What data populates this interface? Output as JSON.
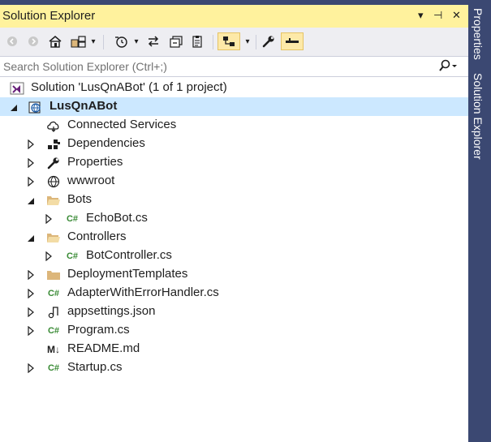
{
  "panel": {
    "title": "Solution Explorer",
    "controls": {
      "dropdown": "▾",
      "pin": "⊣",
      "close": "✕"
    }
  },
  "search": {
    "placeholder": "Search Solution Explorer (Ctrl+;)",
    "icon": "search-icon"
  },
  "tree": {
    "solution": "Solution 'LusQnABot' (1 of 1 project)",
    "project": "LusQnABot",
    "items": [
      {
        "label": "Connected Services",
        "icon": "cloud-icon"
      },
      {
        "label": "Dependencies",
        "icon": "dependencies-icon"
      },
      {
        "label": "Properties",
        "icon": "wrench-icon"
      },
      {
        "label": "wwwroot",
        "icon": "globe-icon"
      },
      {
        "label": "Bots",
        "icon": "folder-open-icon"
      },
      {
        "label": "EchoBot.cs",
        "icon": "csharp-file-icon"
      },
      {
        "label": "Controllers",
        "icon": "folder-open-icon"
      },
      {
        "label": "BotController.cs",
        "icon": "csharp-file-icon"
      },
      {
        "label": "DeploymentTemplates",
        "icon": "folder-icon"
      },
      {
        "label": "AdapterWithErrorHandler.cs",
        "icon": "csharp-file-icon"
      },
      {
        "label": "appsettings.json",
        "icon": "json-file-icon"
      },
      {
        "label": "Program.cs",
        "icon": "csharp-file-icon"
      },
      {
        "label": "README.md",
        "icon": "markdown-file-icon"
      },
      {
        "label": "Startup.cs",
        "icon": "csharp-file-icon"
      }
    ],
    "cs_glyph": "C#",
    "md_glyph": "M↓"
  },
  "sidebar": {
    "tabs": [
      "Properties",
      "Solution Explorer"
    ]
  }
}
